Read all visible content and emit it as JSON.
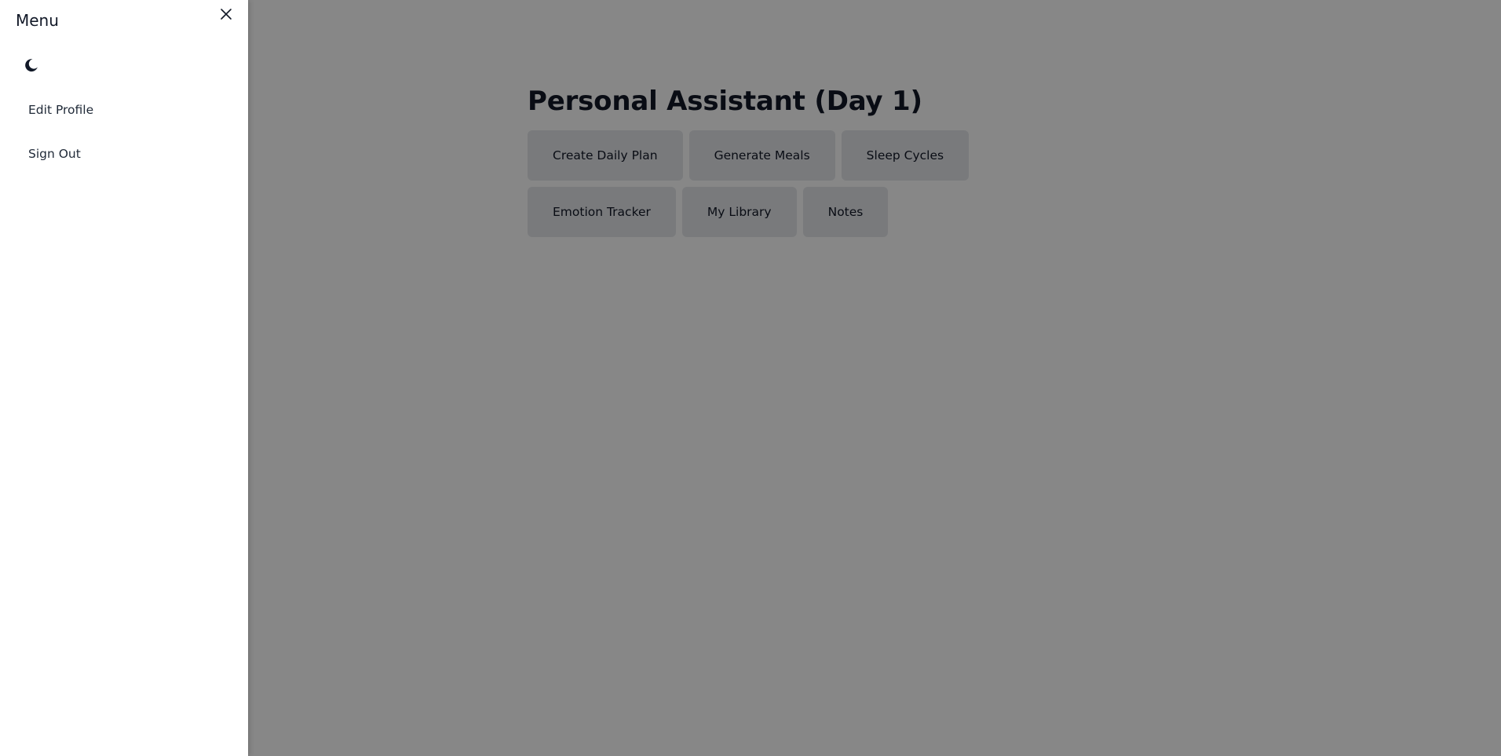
{
  "main": {
    "title": "Personal Assistant (Day 1)",
    "rows": [
      [
        "Create Daily Plan",
        "Generate Meals",
        "Sleep Cycles"
      ],
      [
        "Emotion Tracker",
        "My Library",
        "Notes"
      ]
    ]
  },
  "drawer": {
    "title": "Menu",
    "close_icon": "close-icon",
    "theme_icon": "moon-icon",
    "items": [
      "Edit Profile",
      "Sign Out"
    ]
  },
  "colors": {
    "overlay": "#000000",
    "button_bg": "#e5e7eb",
    "text": "#111827"
  }
}
